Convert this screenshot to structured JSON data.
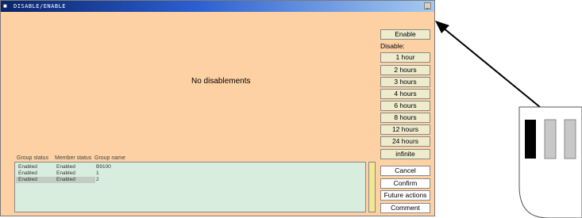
{
  "window": {
    "title": "DISABLE/ENABLE",
    "minimize_glyph": "_"
  },
  "main": {
    "message": "No disablements"
  },
  "table": {
    "headers": [
      "Group status",
      "Member status",
      "Group name"
    ],
    "rows": [
      [
        "Enabled",
        "Enabled",
        "B9100"
      ],
      [
        "Enabled",
        "Enabled",
        "1"
      ],
      [
        "Enabled",
        "Enabled",
        "2"
      ]
    ]
  },
  "buttons": {
    "enable": "Enable",
    "disable_label": "Disable:",
    "durations": [
      "1 hour",
      "2 hours",
      "3 hours",
      "4 hours",
      "6 hours",
      "8 hours",
      "12 hours",
      "24 hours",
      "infinite"
    ],
    "cancel": "Cancel",
    "confirm": "Confirm",
    "future_actions": "Future actions",
    "comment": "Comment"
  },
  "colors": {
    "panel": "#fdd1a4",
    "grid": "#d9eddf",
    "button": "#edeccd",
    "titlebar": "#0a246a"
  }
}
